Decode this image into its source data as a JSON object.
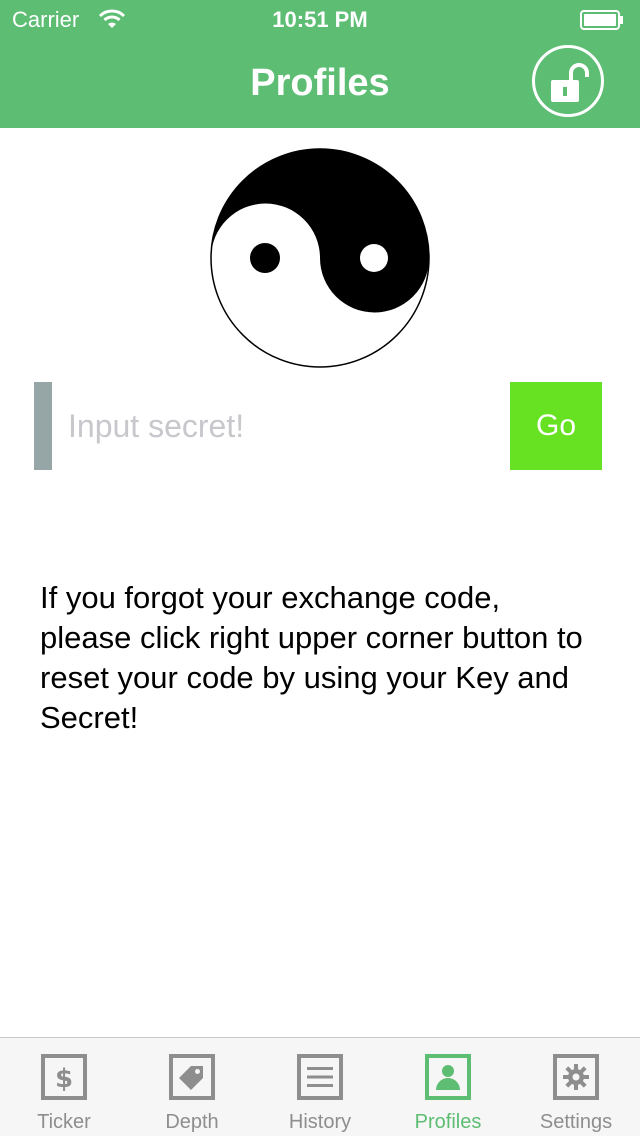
{
  "status_bar": {
    "carrier": "Carrier",
    "time": "10:51 PM"
  },
  "nav": {
    "title": "Profiles",
    "lock_icon": "unlock-icon"
  },
  "colors": {
    "header": "#5cbd73",
    "go_button": "#66e223",
    "input_accent": "#96a5a6",
    "tab_active": "#5cbd73",
    "tab_inactive": "#8e8e8e"
  },
  "secret": {
    "placeholder": "Input secret!",
    "value": "",
    "go_label": "Go"
  },
  "help_text": "If you forgot your exchange code, please click right upper corner button to reset your code by using your Key and Secret!",
  "tabs": [
    {
      "label": "Ticker",
      "icon": "dollar-icon",
      "active": false
    },
    {
      "label": "Depth",
      "icon": "tag-icon",
      "active": false
    },
    {
      "label": "History",
      "icon": "list-icon",
      "active": false
    },
    {
      "label": "Profiles",
      "icon": "person-icon",
      "active": true
    },
    {
      "label": "Settings",
      "icon": "gear-icon",
      "active": false
    }
  ]
}
